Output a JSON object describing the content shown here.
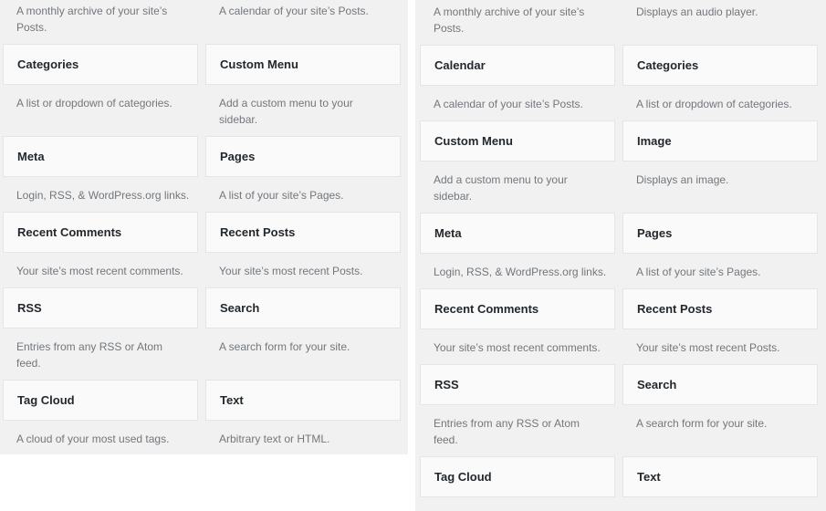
{
  "left_panel": {
    "top_descriptions": [
      "A monthly archive of your site’s Posts.",
      "A calendar of your site’s Posts."
    ],
    "widgets": [
      {
        "title": "Categories",
        "description": "A list or dropdown of categories."
      },
      {
        "title": "Custom Menu",
        "description": "Add a custom menu to your sidebar."
      },
      {
        "title": "Meta",
        "description": "Login, RSS, & WordPress.org links."
      },
      {
        "title": "Pages",
        "description": "A list of your site’s Pages."
      },
      {
        "title": "Recent Comments",
        "description": "Your site’s most recent comments."
      },
      {
        "title": "Recent Posts",
        "description": "Your site’s most recent Posts."
      },
      {
        "title": "RSS",
        "description": "Entries from any RSS or Atom feed."
      },
      {
        "title": "Search",
        "description": "A search form for your site."
      },
      {
        "title": "Tag Cloud",
        "description": "A cloud of your most used tags."
      },
      {
        "title": "Text",
        "description": "Arbitrary text or HTML."
      }
    ]
  },
  "right_panel": {
    "top_descriptions": [
      "A monthly archive of your site’s Posts.",
      "Displays an audio player."
    ],
    "widgets": [
      {
        "title": "Calendar",
        "description": "A calendar of your site’s Posts."
      },
      {
        "title": "Categories",
        "description": "A list or dropdown of categories."
      },
      {
        "title": "Custom Menu",
        "description": "Add a custom menu to your sidebar."
      },
      {
        "title": "Image",
        "description": "Displays an image."
      },
      {
        "title": "Meta",
        "description": "Login, RSS, & WordPress.org links."
      },
      {
        "title": "Pages",
        "description": "A list of your site’s Pages."
      },
      {
        "title": "Recent Comments",
        "description": "Your site’s most recent comments."
      },
      {
        "title": "Recent Posts",
        "description": "Your site’s most recent Posts."
      },
      {
        "title": "RSS",
        "description": "Entries from any RSS or Atom feed."
      },
      {
        "title": "Search",
        "description": "A search form for your site."
      },
      {
        "title": "Tag Cloud",
        "description": ""
      },
      {
        "title": "Text",
        "description": ""
      }
    ]
  }
}
